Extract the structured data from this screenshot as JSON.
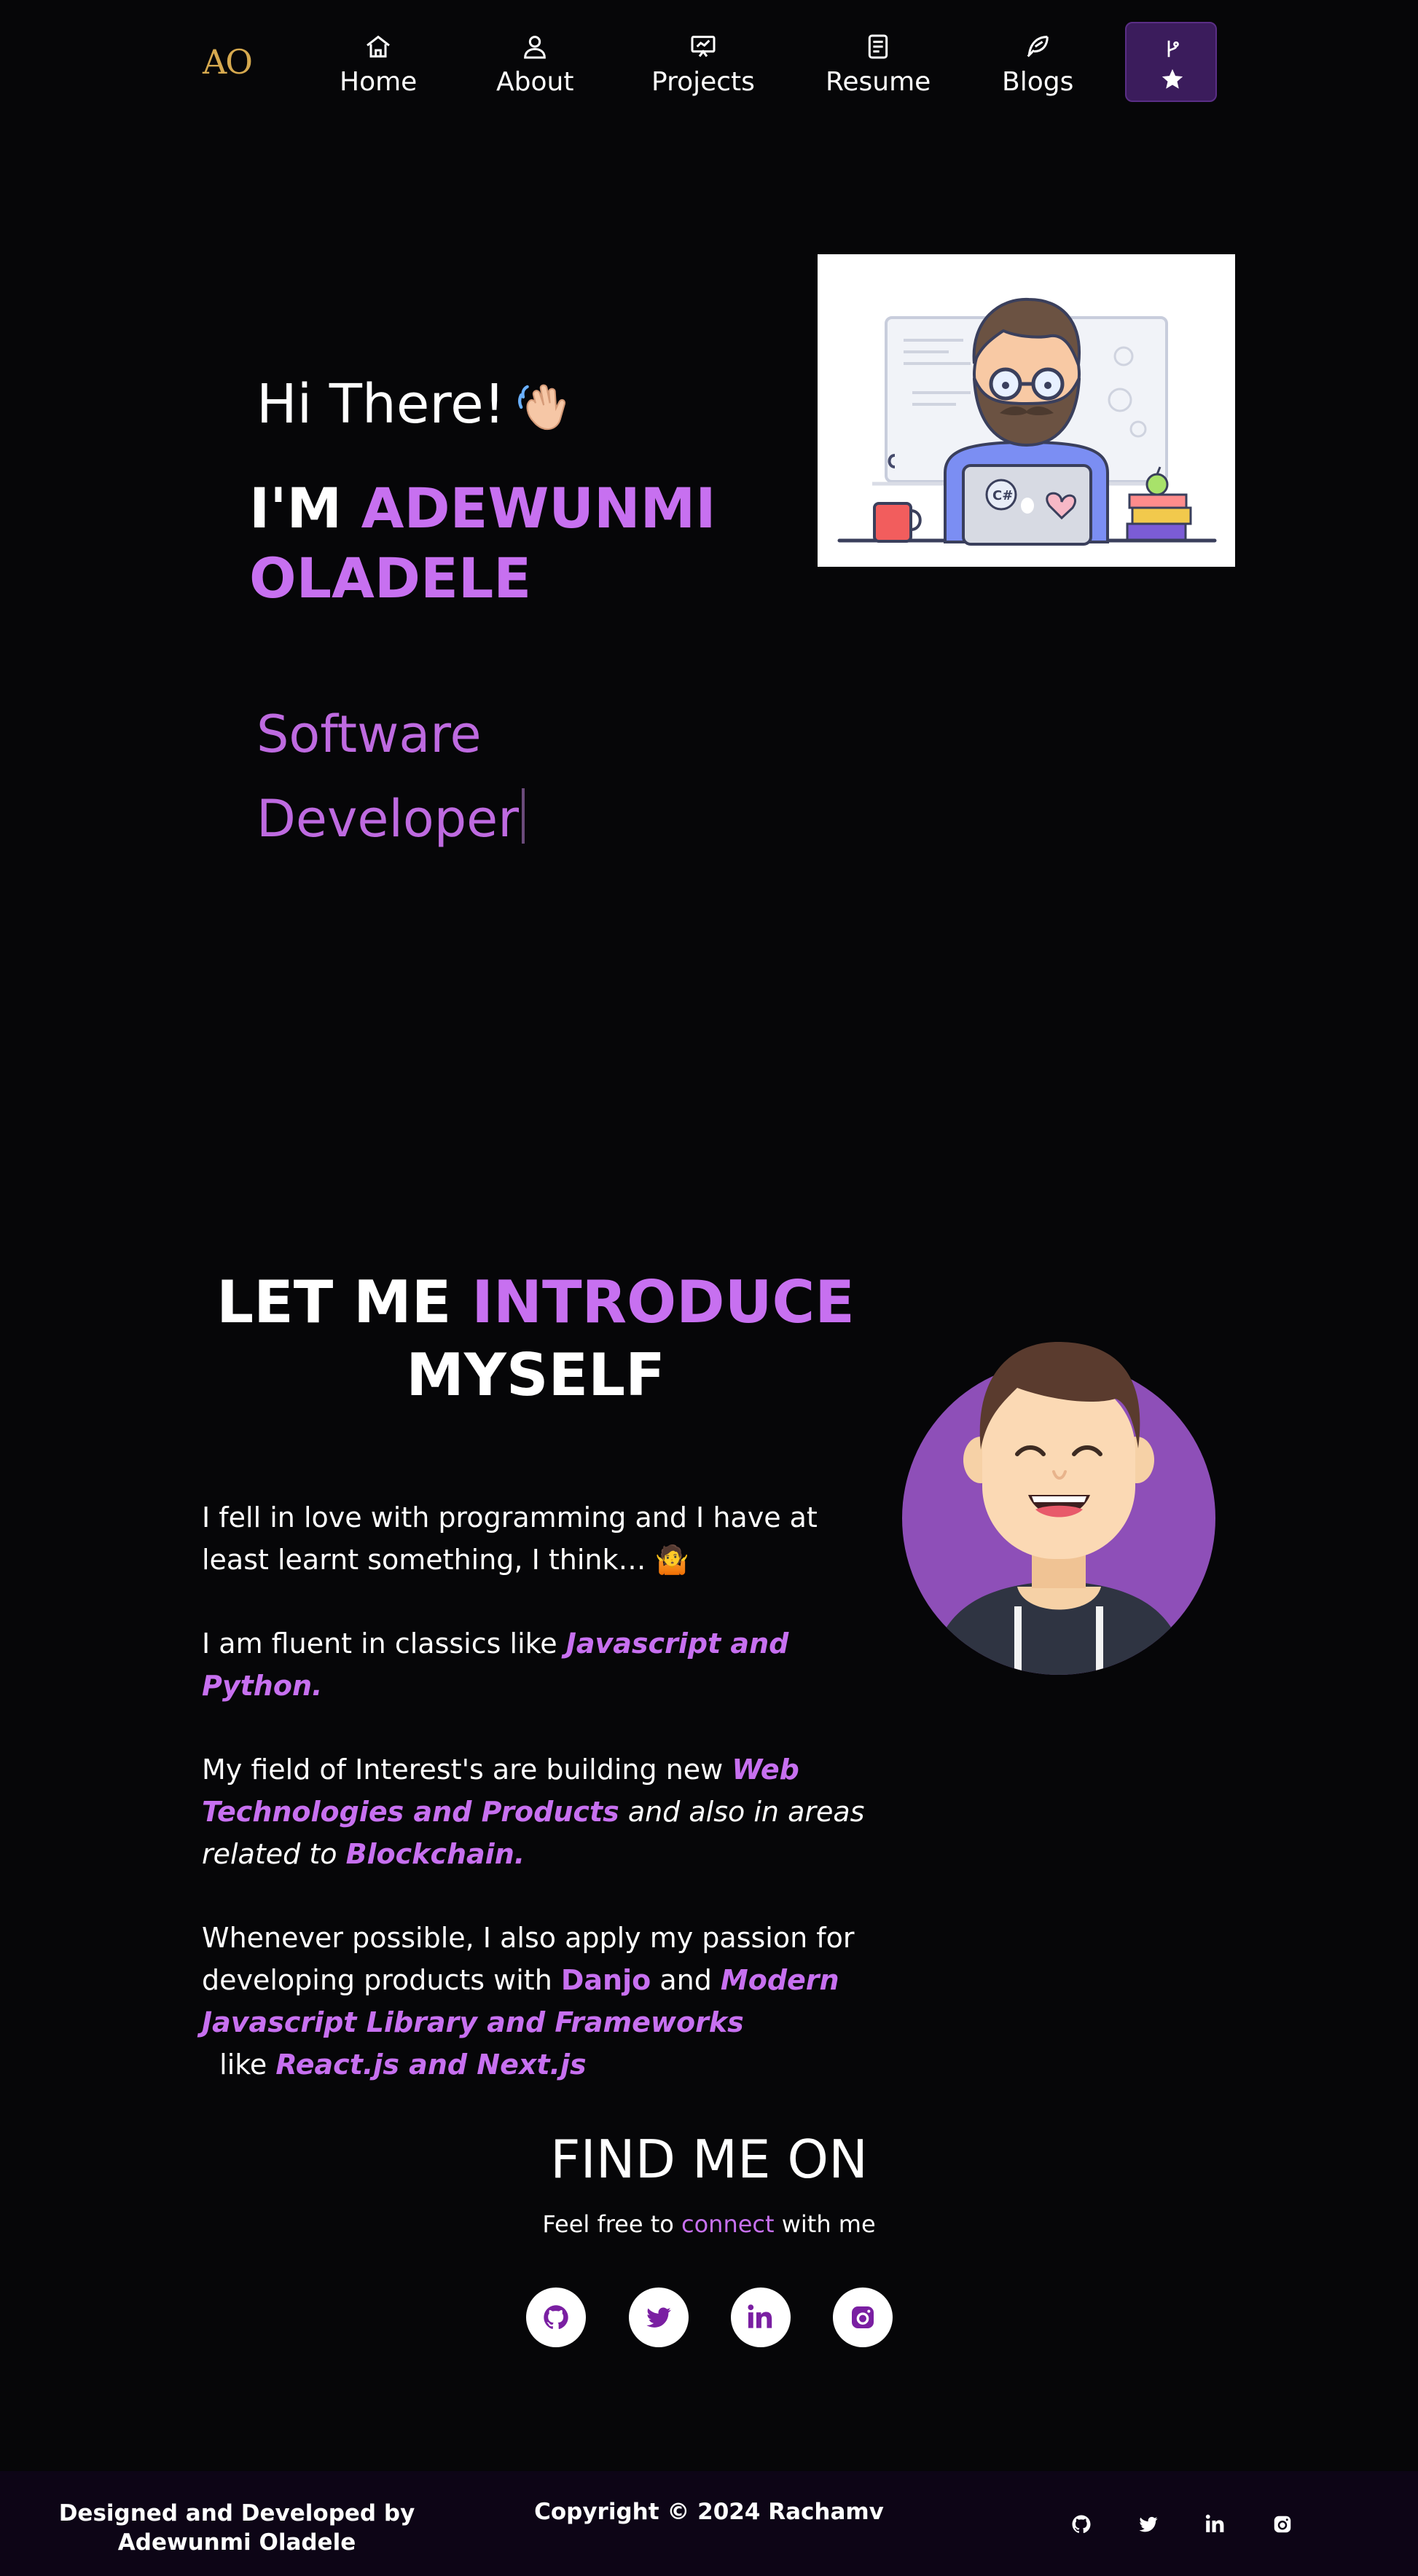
{
  "navbar": {
    "logo": "AO",
    "items": [
      {
        "label": "Home",
        "icon": "home-icon"
      },
      {
        "label": "About",
        "icon": "user-icon"
      },
      {
        "label": "Projects",
        "icon": "presentation-icon"
      },
      {
        "label": "Resume",
        "icon": "document-icon"
      },
      {
        "label": "Blogs",
        "icon": "feather-icon"
      }
    ],
    "fork_button": {
      "icons": [
        "git-branch-icon",
        "star-icon"
      ]
    }
  },
  "hero": {
    "greeting": "Hi There!",
    "greeting_emoji": "waving-hand-icon",
    "name_prefix": "I'M ",
    "name_line1": "ADEWUNMI",
    "name_line2": "OLADELE",
    "typewriter_line1": "Software",
    "typewriter_line2": "Developer",
    "illustration": "developer-at-laptop-illustration"
  },
  "about": {
    "heading_part1": "LET ME ",
    "heading_highlight": "INTRODUCE",
    "heading_part2": "MYSELF",
    "p1": "I fell in love with programming and I have at least learnt something, I think… 🤷",
    "p2_text": "I am fluent in classics like ",
    "p2_emph": "Javascript and Python.",
    "p3_text": "My field of Interest's are building new ",
    "p3_emph1": "Web Technologies and Products",
    "p3_text2": " and also in areas related to ",
    "p3_emph2": "Blockchain.",
    "p4_text": "Whenever possible, I also apply my passion for developing products with ",
    "p4_bold": "Danjo",
    "p4_and": " and ",
    "p4_emph1": "Modern Javascript Library and Frameworks",
    "p4_like": "  like ",
    "p4_emph2": "React.js and Next.js",
    "avatar": "smiling-avatar-illustration"
  },
  "find_me": {
    "heading": "FIND ME ON",
    "sub_prefix": "Feel free to ",
    "sub_link": "connect",
    "sub_suffix": " with me",
    "socials": [
      "github-icon",
      "twitter-icon",
      "linkedin-icon",
      "instagram-icon"
    ]
  },
  "footer": {
    "left": "Designed and Developed by Adewunmi Oladele",
    "copyright": "Copyright © 2024 Rachamv",
    "icons": [
      "github-icon",
      "twitter-icon",
      "linkedin-icon",
      "instagram-icon"
    ]
  },
  "colors": {
    "background": "#060608",
    "accent": "#c770f0",
    "logo": "#d6a94f",
    "fork_button": "#3b1c5c",
    "footer": "#0d0516"
  }
}
